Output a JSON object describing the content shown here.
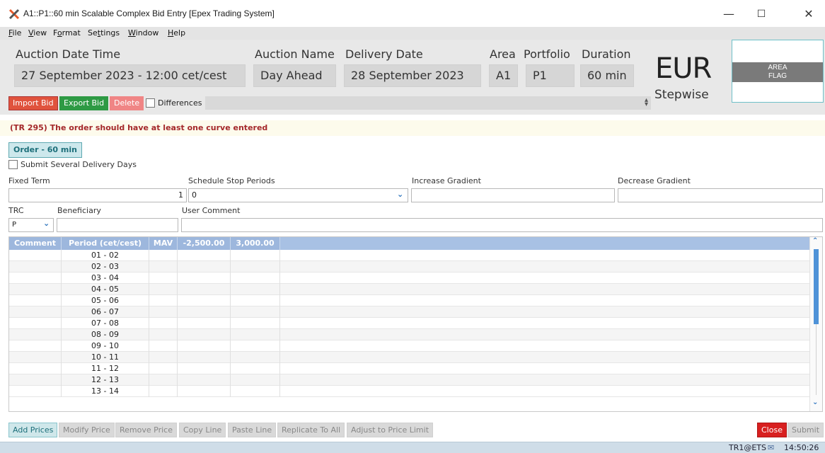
{
  "window": {
    "title": "A1::P1::60 min Scalable Complex Bid Entry [Epex Trading System]",
    "minimize": "—",
    "maximize": "☐",
    "close": "✕"
  },
  "menu": [
    {
      "label": "File",
      "mnemonic": "F",
      "rest": "ile"
    },
    {
      "label": "View",
      "mnemonic": "V",
      "rest": "iew"
    },
    {
      "label": "Format",
      "mnemonic": "o",
      "pre": "F",
      "rest": "rmat"
    },
    {
      "label": "Settings",
      "mnemonic": "t",
      "pre": "Se",
      "rest": "tings"
    },
    {
      "label": "Window",
      "mnemonic": "W",
      "rest": "indow"
    },
    {
      "label": "Help",
      "mnemonic": "H",
      "rest": "elp"
    }
  ],
  "header": {
    "auction_date_time_label": "Auction Date Time",
    "auction_date_time": "27 September 2023 - 12:00 cet/cest",
    "auction_name_label": "Auction Name",
    "auction_name": "Day Ahead",
    "delivery_date_label": "Delivery Date",
    "delivery_date": "28 September 2023",
    "area_label": "Area",
    "area": "A1",
    "portfolio_label": "Portfolio",
    "portfolio": "P1",
    "duration_label": "Duration",
    "duration": "60 min",
    "currency": "EUR",
    "curve_type": "Stepwise",
    "area_flag_line1": "AREA",
    "area_flag_line2": "FLAG"
  },
  "toolbar": {
    "import_label": "Import Bid",
    "export_label": "Export Bid",
    "delete_label": "Delete",
    "differences_label": "Differences"
  },
  "warning": "(TR 295) The order should have at least one curve entered",
  "order_tab": "Order - 60 min",
  "form": {
    "submit_several_label": "Submit Several Delivery Days",
    "fixed_term_label": "Fixed Term",
    "fixed_term_value": "1",
    "schedule_stop_label": "Schedule Stop Periods",
    "schedule_stop_value": "0",
    "increase_gradient_label": "Increase Gradient",
    "decrease_gradient_label": "Decrease Gradient",
    "trc_label": "TRC",
    "trc_value": "P",
    "beneficiary_label": "Beneficiary",
    "user_comment_label": "User Comment"
  },
  "table": {
    "columns": [
      "Comment",
      "Period (cet/cest)",
      "MAV",
      "-2,500.00",
      "3,000.00"
    ],
    "periods": [
      "01 - 02",
      "02 - 03",
      "03 - 04",
      "04 - 05",
      "05 - 06",
      "06 - 07",
      "07 - 08",
      "08 - 09",
      "09 - 10",
      "10 - 11",
      "11 - 12",
      "12 - 13",
      "13 - 14"
    ]
  },
  "bottom_buttons": {
    "add_prices": "Add Prices",
    "modify_price": "Modify Price",
    "remove_price": "Remove Price",
    "copy_line": "Copy Line",
    "paste_line": "Paste Line",
    "replicate_to_all": "Replicate To All",
    "adjust_price_limit": "Adjust to Price Limit",
    "close": "Close",
    "submit": "Submit"
  },
  "status": {
    "user": "TR1@ETS",
    "time": "14:50:26"
  },
  "colors": {
    "import": "#e0533d",
    "export": "#2e9a44",
    "delete": "#f08585",
    "close": "#d82020",
    "warning_text": "#a4282a",
    "table_header": "#9db7dd",
    "accent": "#1d6f7a"
  }
}
